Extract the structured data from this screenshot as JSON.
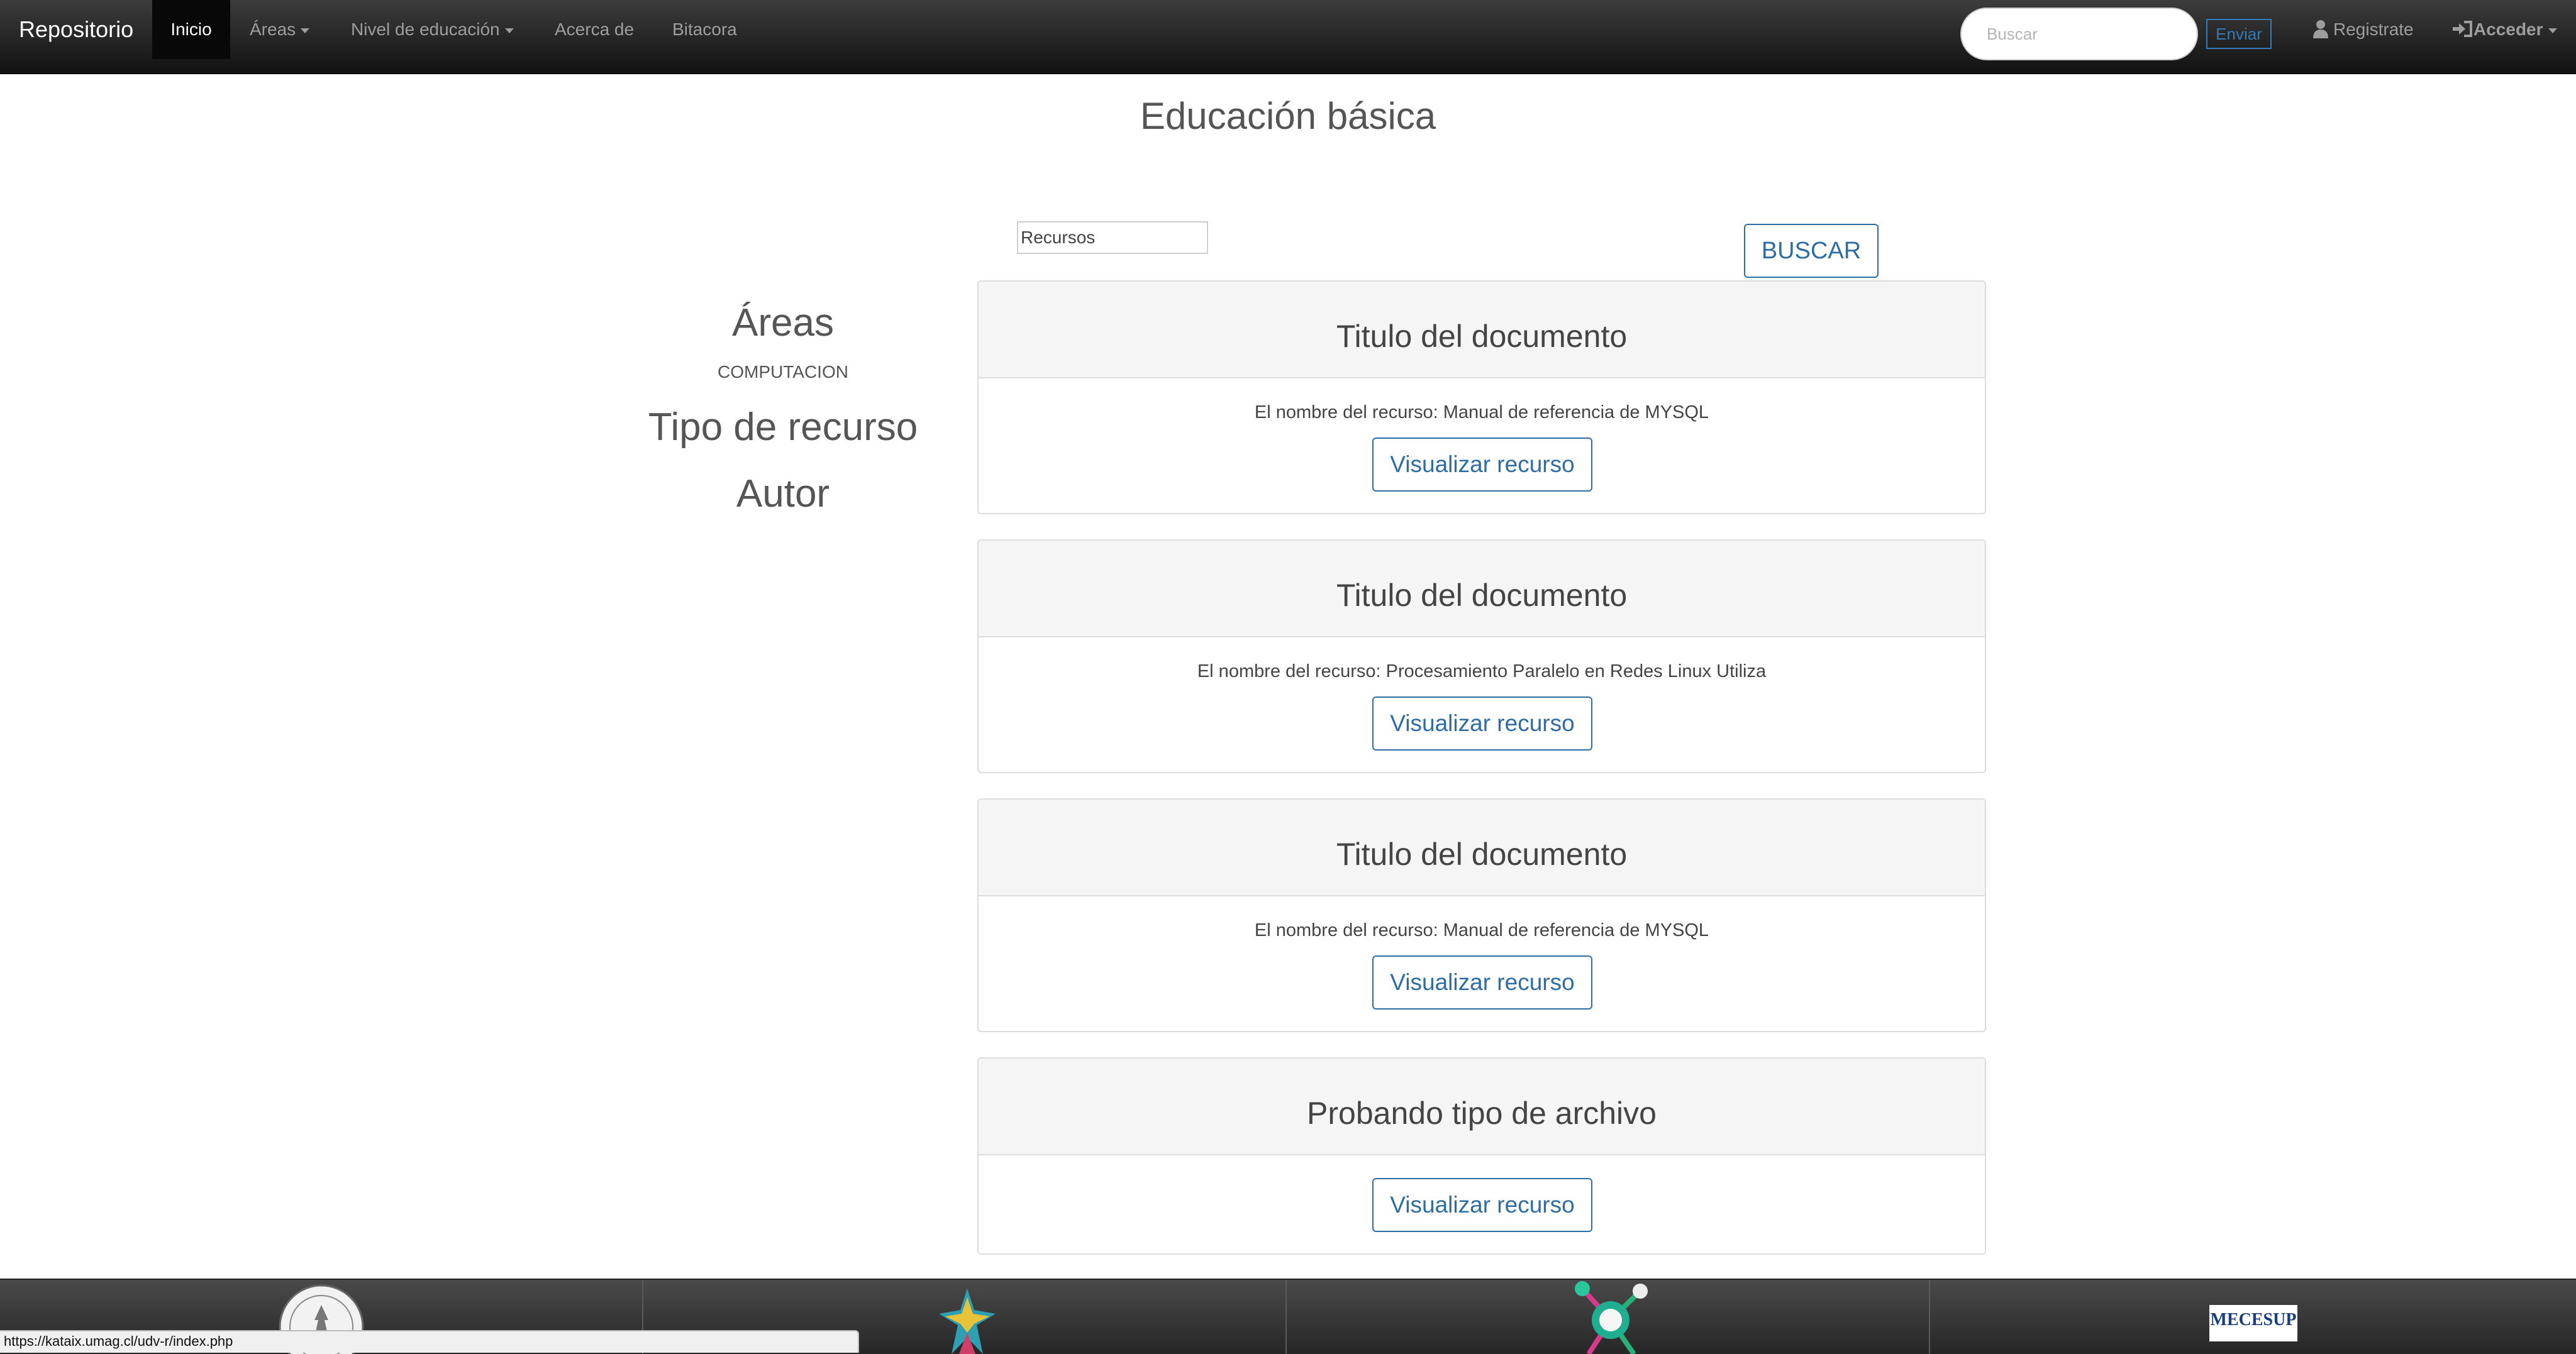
{
  "navbar": {
    "brand": "Repositorio",
    "items": [
      {
        "label": "Inicio"
      },
      {
        "label": "Áreas"
      },
      {
        "label": "Nivel de educación"
      },
      {
        "label": "Acerca de"
      },
      {
        "label": "Bitacora"
      }
    ],
    "search_placeholder": "Buscar",
    "send_label": "Enviar",
    "register_label": "Registrate",
    "signin_label": "Acceder",
    "icons": {
      "user": "user-icon",
      "signin": "sign-in-icon",
      "caret": "caret-down-icon"
    }
  },
  "page": {
    "title": "Educación básica"
  },
  "filter": {
    "resource_field_value": "Recursos",
    "search_button": "BUSCAR"
  },
  "sidebar": {
    "areas_heading": "Áreas",
    "areas_items": [
      "COMPUTACION"
    ],
    "resource_type_heading": "Tipo de recurso",
    "author_heading": "Autor"
  },
  "cards": [
    {
      "title": "Titulo del documento",
      "text": "El nombre del recurso: Manual de referencia de MYSQL",
      "button": "Visualizar recurso"
    },
    {
      "title": "Titulo del documento",
      "text": "El nombre del recurso: Procesamiento Paralelo en Redes Linux Utiliza",
      "button": "Visualizar recurso"
    },
    {
      "title": "Titulo del documento",
      "text": "El nombre del recurso: Manual de referencia de MYSQL",
      "button": "Visualizar recurso"
    },
    {
      "title": "Probando tipo de archivo",
      "button": "Visualizar recurso"
    }
  ],
  "footer": {
    "logos": [
      "university-seal-logo",
      "star-figure-logo",
      "molecule-logo",
      "mecesup-logo"
    ],
    "mecesup_text": "MECESUP"
  },
  "status_bar": {
    "url": "https://kataix.umag.cl/udv-r/index.php"
  },
  "colors": {
    "link": "#337ab7",
    "navbar": "#222222",
    "button_border": "#2e6da4"
  }
}
